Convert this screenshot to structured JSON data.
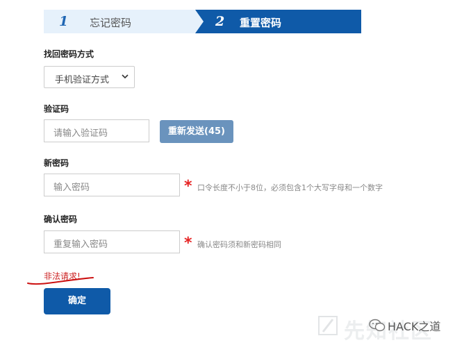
{
  "steps": [
    {
      "number": "1",
      "label": "忘记密码"
    },
    {
      "number": "2",
      "label": "重置密码"
    }
  ],
  "method": {
    "label": "找回密码方式",
    "selected": "手机验证方式"
  },
  "code": {
    "label": "验证码",
    "placeholder": "请输入验证码",
    "resend_label": "重新发送(45)"
  },
  "new_password": {
    "label": "新密码",
    "placeholder": "输入密码",
    "required_mark": "*",
    "hint": "口令长度不小于8位，必须包含1个大写字母和一个数字"
  },
  "confirm_password": {
    "label": "确认密码",
    "placeholder": "重复输入密码",
    "required_mark": "*",
    "hint": "确认密码须和新密码相同"
  },
  "error_message": "非法请求!",
  "confirm_button": "确定",
  "watermark": {
    "faded_text": "先知社区",
    "account": "HACK之道"
  },
  "colors": {
    "primary": "#0f5aa8",
    "resend": "#6a93bd",
    "error": "#cc2222",
    "required": "#e62424"
  }
}
